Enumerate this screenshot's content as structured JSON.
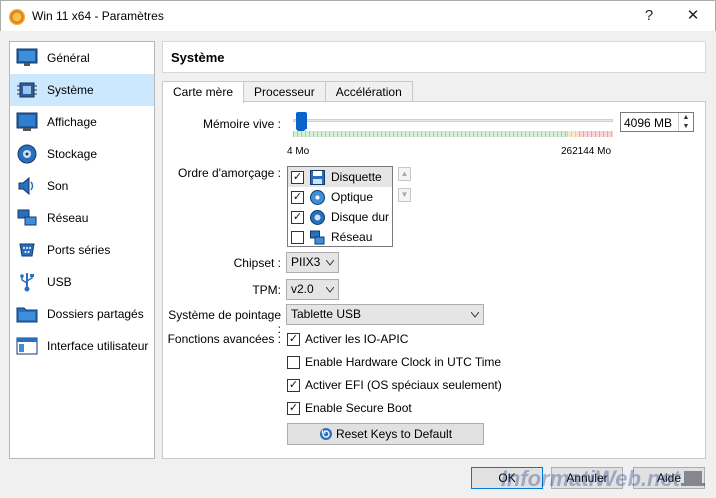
{
  "window": {
    "title": "Win 11 x64 - Paramètres",
    "help_glyph": "?",
    "close_glyph": "✕"
  },
  "sidebar": {
    "items": [
      {
        "label": "Général",
        "icon": "monitor-icon"
      },
      {
        "label": "Système",
        "icon": "chip-icon",
        "selected": true
      },
      {
        "label": "Affichage",
        "icon": "display-icon"
      },
      {
        "label": "Stockage",
        "icon": "disk-icon"
      },
      {
        "label": "Son",
        "icon": "speaker-icon"
      },
      {
        "label": "Réseau",
        "icon": "network-icon"
      },
      {
        "label": "Ports séries",
        "icon": "serial-port-icon"
      },
      {
        "label": "USB",
        "icon": "usb-icon"
      },
      {
        "label": "Dossiers partagés",
        "icon": "folder-icon"
      },
      {
        "label": "Interface utilisateur",
        "icon": "ui-window-icon"
      }
    ]
  },
  "main": {
    "title": "Système",
    "tabs": [
      {
        "label": "Carte mère",
        "active": true
      },
      {
        "label": "Processeur"
      },
      {
        "label": "Accélération"
      }
    ]
  },
  "memory": {
    "label": "Mémoire vive :",
    "value": "4096 MB",
    "min_label": "4 Mo",
    "max_label": "262144 Mo",
    "slider_fraction": 0.015
  },
  "boot": {
    "label": "Ordre d'amorçage :",
    "items": [
      {
        "label": "Disquette",
        "checked": true,
        "icon": "floppy-icon"
      },
      {
        "label": "Optique",
        "checked": true,
        "icon": "optical-disc-icon"
      },
      {
        "label": "Disque dur",
        "checked": true,
        "icon": "hard-disk-icon"
      },
      {
        "label": "Réseau",
        "checked": false,
        "icon": "network-icon"
      }
    ]
  },
  "chipset": {
    "label": "Chipset :",
    "value": "PIIX3"
  },
  "tpm": {
    "label": "TPM:",
    "value": "v2.0"
  },
  "pointing": {
    "label": "Système de pointage :",
    "value": "Tablette USB"
  },
  "advanced": {
    "label": "Fonctions avancées :",
    "options": [
      {
        "label": "Activer les IO-APIC",
        "checked": true
      },
      {
        "label": "Enable Hardware Clock in UTC Time",
        "checked": false
      },
      {
        "label": "Activer EFI (OS spéciaux seulement)",
        "checked": true
      },
      {
        "label": "Enable Secure Boot",
        "checked": true
      }
    ],
    "reset_button": "Reset Keys to Default"
  },
  "footer": {
    "ok": "OK",
    "cancel": "Annuler",
    "help": "Aide"
  },
  "watermark": "InformatiWeb.net",
  "colors": {
    "selection": "#cce8ff",
    "slider": "#0a64c8",
    "accent_border": "#0078d7"
  }
}
